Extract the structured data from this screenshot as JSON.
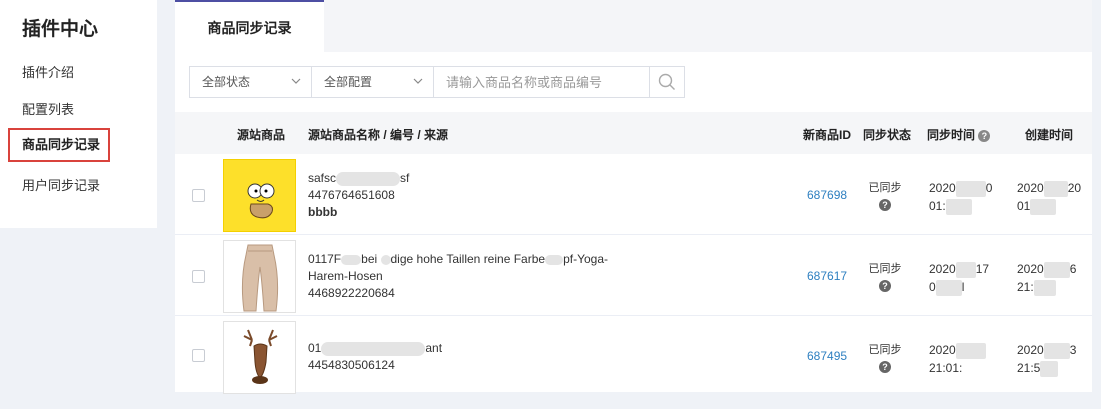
{
  "sidebar": {
    "title": "插件中心",
    "items": [
      {
        "label": "插件介绍"
      },
      {
        "label": "配置列表"
      },
      {
        "label": "商品同步记录"
      },
      {
        "label": "用户同步记录"
      }
    ]
  },
  "tab": {
    "label": "商品同步记录"
  },
  "filters": {
    "status": "全部状态",
    "config": "全部配置",
    "search_placeholder": "请输入商品名称或商品编号"
  },
  "table": {
    "headers": [
      "源站商品",
      "源站商品名称 / 编号 / 来源",
      "新商品ID",
      "同步状态",
      "同步时间",
      "创建时间"
    ],
    "rows": [
      {
        "name_line1": "safsc",
        "name_line1_end": "sf",
        "code": "4476764651608",
        "source": "bbbb",
        "new_id": "687698",
        "status": "已同步",
        "sync_time_1": "2020",
        "sync_time_1_end": "0",
        "sync_time_2": "01:",
        "create_time_1": "2020",
        "create_time_1_end": "20",
        "create_time_2": "01"
      },
      {
        "name_line1": "0117F",
        "name_line1_mid": "bei",
        "name_line1_mid2": "dige hohe Taillen reine Farbe",
        "name_line1_end": "pf-Yoga-",
        "name_line2": "Harem-Hosen",
        "code": "4468922220684",
        "new_id": "687617",
        "status": "已同步",
        "sync_time_1": "2020",
        "sync_time_1_end": "17",
        "sync_time_2": "0",
        "sync_time_2_end": "l",
        "create_time_1": "2020",
        "create_time_1_end": "6",
        "create_time_2": "21:"
      },
      {
        "name_line1": "01",
        "name_line1_end": "ant",
        "code": "4454830506124",
        "new_id": "687495",
        "status": "已同步",
        "sync_time_1": "2020",
        "sync_time_2": "21:01:",
        "create_time_1": "2020",
        "create_time_1_end": "3",
        "create_time_2": "21:5"
      }
    ]
  },
  "colors": {
    "accent": "#4d4fa3",
    "link": "#2d7fc0",
    "active_border": "#d9433c"
  }
}
